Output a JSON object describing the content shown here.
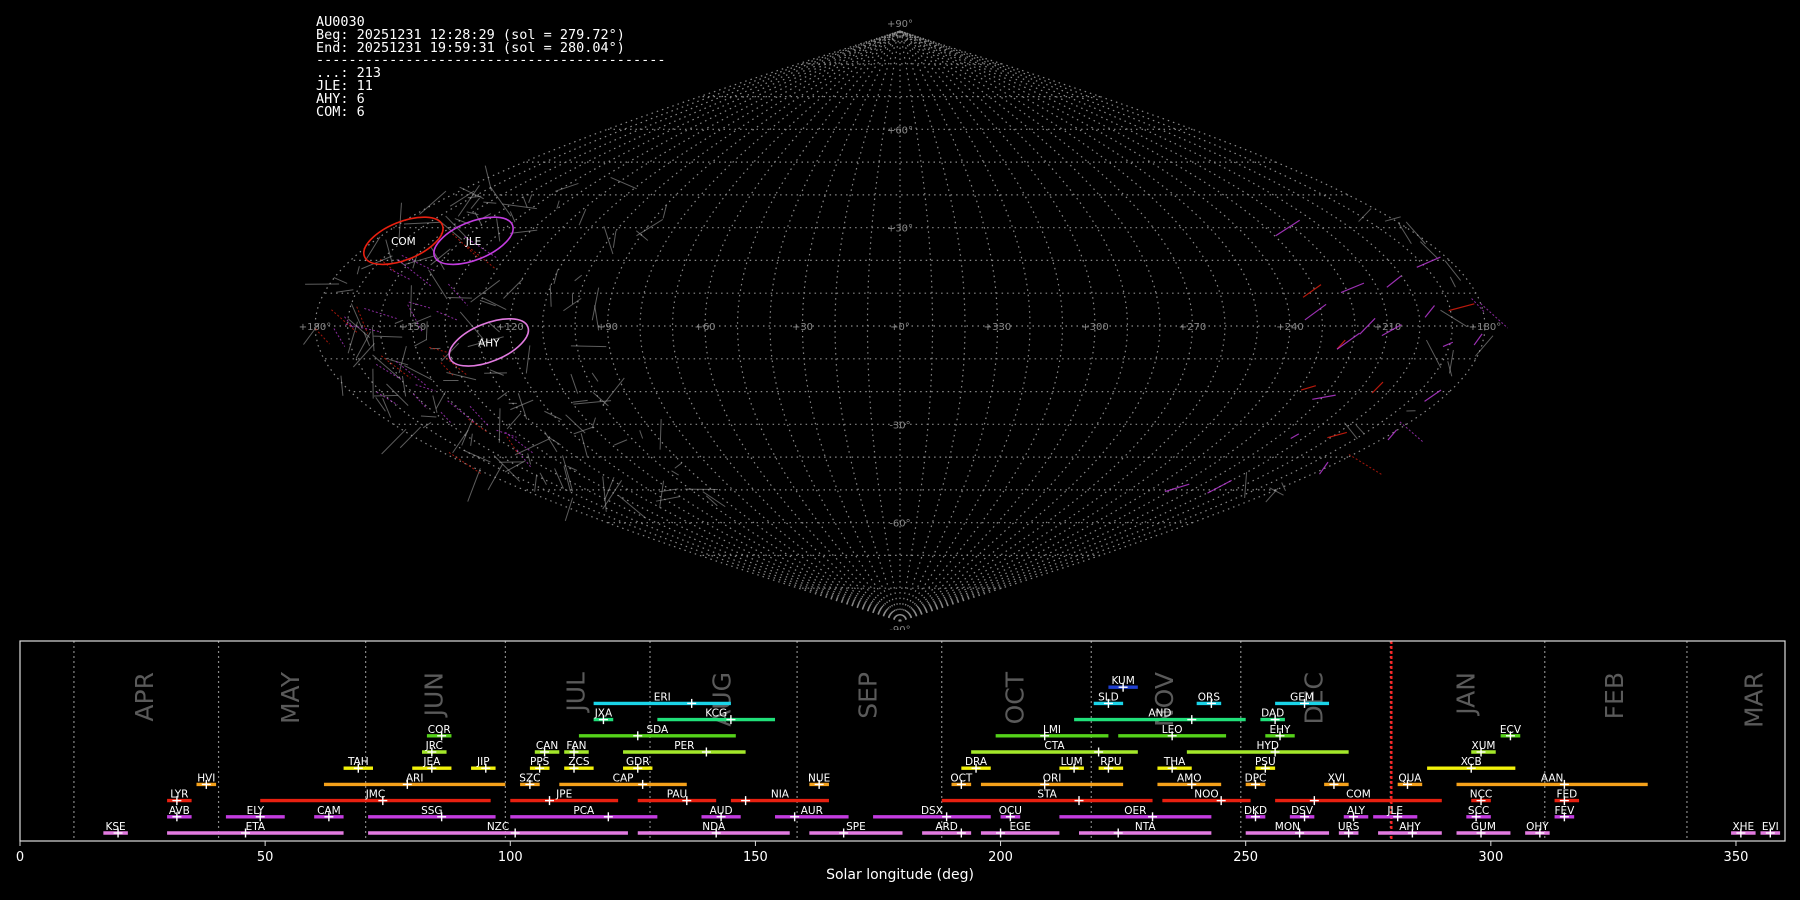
{
  "info": {
    "station": "AU0030",
    "begin": "Beg: 20251231 12:28:29 (sol = 279.72°)",
    "end": "End: 20251231 19:59:31 (sol = 280.04°)",
    "separator": "-------------------------------------------",
    "counts": [
      {
        "code": "...",
        "count": 213
      },
      {
        "code": "JLE",
        "count": 11
      },
      {
        "code": "AHY",
        "count": 6
      },
      {
        "code": "COM",
        "count": 6
      }
    ]
  },
  "colors": {
    "background": "#000000",
    "grid": "#8a8a8a",
    "sporadic": "#aaaaaa",
    "current_sol_marker": "#ff2020",
    "shower_palette": {
      "blue": "#1f3fd0",
      "cyan": "#1ad4e8",
      "spring": "#20e07a",
      "green": "#55d21a",
      "lime": "#a4e82a",
      "yellow": "#f2f20a",
      "orange": "#f5a11a",
      "red": "#e82010",
      "magenta": "#c33ce0",
      "pink": "#e27ae0"
    }
  },
  "chart_data": [
    {
      "type": "scatter",
      "projection": "sinusoidal",
      "grid": true,
      "lon_tick_labels": [
        "+180°",
        "+150",
        "+120",
        "+90",
        "+60",
        "+30",
        "+0°",
        "+330",
        "+300",
        "+270",
        "+240",
        "+210",
        "+180°"
      ],
      "lat_tick_labels": [
        "+90°",
        "+60°",
        "+30°",
        "+0°",
        "-30°",
        "-60°",
        "-90°"
      ],
      "radiants": [
        {
          "code": "COM",
          "lon": 170,
          "lat": 26,
          "color": "#e82010"
        },
        {
          "code": "JLE",
          "lon": 146,
          "lat": 26,
          "color": "#c33ce0"
        },
        {
          "code": "AHY",
          "lon": 127,
          "lat": -5,
          "color": "#e27ae0"
        }
      ]
    },
    {
      "type": "timeline",
      "xlabel": "Solar longitude (deg)",
      "xlim": [
        0,
        360
      ],
      "grid": true,
      "x_ticks": [
        0,
        50,
        100,
        150,
        200,
        250,
        300,
        350
      ],
      "current_sol": 279.72,
      "months": [
        {
          "label": "APR",
          "start": 11,
          "end": 40.5
        },
        {
          "label": "MAY",
          "start": 40.5,
          "end": 70.5
        },
        {
          "label": "JUN",
          "start": 70.5,
          "end": 99
        },
        {
          "label": "JUL",
          "start": 99,
          "end": 128.5
        },
        {
          "label": "AUG",
          "start": 128.5,
          "end": 158.5
        },
        {
          "label": "SEP",
          "start": 158.5,
          "end": 188
        },
        {
          "label": "OCT",
          "start": 188,
          "end": 218.5
        },
        {
          "label": "NOV",
          "start": 218.5,
          "end": 249
        },
        {
          "label": "DEC",
          "start": 249,
          "end": 279.5
        },
        {
          "label": "JAN",
          "start": 279.5,
          "end": 311
        },
        {
          "label": "FEB",
          "start": 311,
          "end": 340
        },
        {
          "label": "MAR",
          "start": 340,
          "end": 371
        }
      ],
      "showers": [
        {
          "code": "KUM",
          "start": 222,
          "end": 228,
          "peak": 225,
          "row": 9,
          "color": "#1f3fd0"
        },
        {
          "code": "ERI",
          "start": 117,
          "end": 145,
          "peak": 137,
          "row": 8,
          "color": "#1ad4e8"
        },
        {
          "code": "SLD",
          "start": 219,
          "end": 225,
          "peak": 222,
          "row": 8,
          "color": "#1ad4e8"
        },
        {
          "code": "ORS",
          "start": 240,
          "end": 245,
          "peak": 243,
          "row": 8,
          "color": "#1ad4e8"
        },
        {
          "code": "GEM",
          "start": 256,
          "end": 267,
          "peak": 262,
          "row": 8,
          "color": "#1ad4e8"
        },
        {
          "code": "JXA",
          "start": 117,
          "end": 121,
          "peak": 119,
          "row": 7,
          "color": "#20e07a"
        },
        {
          "code": "KCG",
          "start": 130,
          "end": 154,
          "peak": 145,
          "row": 7,
          "color": "#20e07a"
        },
        {
          "code": "AND",
          "start": 215,
          "end": 250,
          "peak": 239,
          "row": 7,
          "color": "#20e07a"
        },
        {
          "code": "DAD",
          "start": 253,
          "end": 258,
          "peak": 256,
          "row": 7,
          "color": "#20e07a"
        },
        {
          "code": "COR",
          "start": 83,
          "end": 88,
          "peak": 86,
          "row": 6,
          "color": "#55d21a"
        },
        {
          "code": "SDA",
          "start": 114,
          "end": 146,
          "peak": 126,
          "row": 6,
          "color": "#55d21a"
        },
        {
          "code": "LMI",
          "start": 199,
          "end": 222,
          "peak": 209,
          "row": 6,
          "color": "#55d21a"
        },
        {
          "code": "LEO",
          "start": 224,
          "end": 246,
          "peak": 235,
          "row": 6,
          "color": "#55d21a"
        },
        {
          "code": "EHY",
          "start": 254,
          "end": 260,
          "peak": 257,
          "row": 6,
          "color": "#55d21a"
        },
        {
          "code": "ECV",
          "start": 302,
          "end": 306,
          "peak": 304,
          "row": 6,
          "color": "#55d21a"
        },
        {
          "code": "JRC",
          "start": 82,
          "end": 87,
          "peak": 84,
          "row": 5,
          "color": "#a4e82a"
        },
        {
          "code": "CAN",
          "start": 105,
          "end": 110,
          "peak": 107,
          "row": 5,
          "color": "#a4e82a"
        },
        {
          "code": "FAN",
          "start": 111,
          "end": 116,
          "peak": 113,
          "row": 5,
          "color": "#a4e82a"
        },
        {
          "code": "PER",
          "start": 123,
          "end": 148,
          "peak": 140,
          "row": 5,
          "color": "#a4e82a"
        },
        {
          "code": "CTA",
          "start": 194,
          "end": 228,
          "peak": 220,
          "row": 5,
          "color": "#a4e82a"
        },
        {
          "code": "HYD",
          "start": 238,
          "end": 271,
          "peak": 256,
          "row": 5,
          "color": "#a4e82a"
        },
        {
          "code": "XUM",
          "start": 296,
          "end": 301,
          "peak": 298,
          "row": 5,
          "color": "#a4e82a"
        },
        {
          "code": "TAH",
          "start": 66,
          "end": 72,
          "peak": 69,
          "row": 4,
          "color": "#f2f20a"
        },
        {
          "code": "JEA",
          "start": 80,
          "end": 88,
          "peak": 84,
          "row": 4,
          "color": "#f2f20a"
        },
        {
          "code": "JIP",
          "start": 92,
          "end": 97,
          "peak": 95,
          "row": 4,
          "color": "#f2f20a"
        },
        {
          "code": "PPS",
          "start": 104,
          "end": 108,
          "peak": 106,
          "row": 4,
          "color": "#f2f20a"
        },
        {
          "code": "ZCS",
          "start": 111,
          "end": 117,
          "peak": 113,
          "row": 4,
          "color": "#f2f20a"
        },
        {
          "code": "GDR",
          "start": 123,
          "end": 129,
          "peak": 126,
          "row": 4,
          "color": "#f2f20a"
        },
        {
          "code": "DRA",
          "start": 192,
          "end": 198,
          "peak": 195,
          "row": 4,
          "color": "#f2f20a"
        },
        {
          "code": "LUM",
          "start": 212,
          "end": 217,
          "peak": 215,
          "row": 4,
          "color": "#f2f20a"
        },
        {
          "code": "RPU",
          "start": 220,
          "end": 225,
          "peak": 222,
          "row": 4,
          "color": "#f2f20a"
        },
        {
          "code": "THA",
          "start": 232,
          "end": 239,
          "peak": 235,
          "row": 4,
          "color": "#f2f20a"
        },
        {
          "code": "PSU",
          "start": 252,
          "end": 256,
          "peak": 254,
          "row": 4,
          "color": "#f2f20a"
        },
        {
          "code": "XCB",
          "start": 287,
          "end": 305,
          "peak": 296,
          "row": 4,
          "color": "#f2f20a"
        },
        {
          "code": "HVI",
          "start": 36,
          "end": 40,
          "peak": 38,
          "row": 3,
          "color": "#f5a11a"
        },
        {
          "code": "ARI",
          "start": 62,
          "end": 99,
          "peak": 79,
          "row": 3,
          "color": "#f5a11a"
        },
        {
          "code": "SZC",
          "start": 102,
          "end": 106,
          "peak": 104,
          "row": 3,
          "color": "#f5a11a"
        },
        {
          "code": "CAP",
          "start": 110,
          "end": 136,
          "peak": 127,
          "row": 3,
          "color": "#f5a11a"
        },
        {
          "code": "NUE",
          "start": 161,
          "end": 165,
          "peak": 163,
          "row": 3,
          "color": "#f5a11a"
        },
        {
          "code": "OCT",
          "start": 190,
          "end": 194,
          "peak": 192,
          "row": 3,
          "color": "#f5a11a"
        },
        {
          "code": "ORI",
          "start": 196,
          "end": 225,
          "peak": 209,
          "row": 3,
          "color": "#f5a11a"
        },
        {
          "code": "AMO",
          "start": 232,
          "end": 245,
          "peak": 239,
          "row": 3,
          "color": "#f5a11a"
        },
        {
          "code": "DPC",
          "start": 250,
          "end": 254,
          "peak": 252,
          "row": 3,
          "color": "#f5a11a"
        },
        {
          "code": "XVI",
          "start": 266,
          "end": 271,
          "peak": 268,
          "row": 3,
          "color": "#f5a11a"
        },
        {
          "code": "QUA",
          "start": 281,
          "end": 286,
          "peak": 283,
          "row": 3,
          "color": "#f5a11a"
        },
        {
          "code": "AAN",
          "start": 293,
          "end": 332,
          "peak": 315,
          "row": 3,
          "color": "#f5a11a"
        },
        {
          "code": "LYR",
          "start": 30,
          "end": 35,
          "peak": 32,
          "row": 2,
          "color": "#e82010"
        },
        {
          "code": "JMC",
          "start": 49,
          "end": 96,
          "peak": 74,
          "row": 2,
          "color": "#e82010"
        },
        {
          "code": "JPE",
          "start": 100,
          "end": 122,
          "peak": 108,
          "row": 2,
          "color": "#e82010"
        },
        {
          "code": "PAU",
          "start": 126,
          "end": 142,
          "peak": 136,
          "row": 2,
          "color": "#e82010"
        },
        {
          "code": "NIA",
          "start": 145,
          "end": 165,
          "peak": 148,
          "row": 2,
          "color": "#e82010"
        },
        {
          "code": "STA",
          "start": 188,
          "end": 231,
          "peak": 216,
          "row": 2,
          "color": "#e82010"
        },
        {
          "code": "NOO",
          "start": 233,
          "end": 251,
          "peak": 245,
          "row": 2,
          "color": "#e82010"
        },
        {
          "code": "COM",
          "start": 256,
          "end": 290,
          "peak": 264,
          "row": 2,
          "color": "#e82010"
        },
        {
          "code": "NCC",
          "start": 296,
          "end": 300,
          "peak": 298,
          "row": 2,
          "color": "#e82010"
        },
        {
          "code": "FED",
          "start": 313,
          "end": 318,
          "peak": 315,
          "row": 2,
          "color": "#e82010"
        },
        {
          "code": "AVB",
          "start": 30,
          "end": 35,
          "peak": 32,
          "row": 1,
          "color": "#c33ce0"
        },
        {
          "code": "ELY",
          "start": 42,
          "end": 54,
          "peak": 49,
          "row": 1,
          "color": "#c33ce0"
        },
        {
          "code": "CAM",
          "start": 60,
          "end": 66,
          "peak": 63,
          "row": 1,
          "color": "#c33ce0"
        },
        {
          "code": "SSG",
          "start": 71,
          "end": 97,
          "peak": 86,
          "row": 1,
          "color": "#c33ce0"
        },
        {
          "code": "PCA",
          "start": 100,
          "end": 130,
          "peak": 120,
          "row": 1,
          "color": "#c33ce0"
        },
        {
          "code": "AUD",
          "start": 139,
          "end": 147,
          "peak": 143,
          "row": 1,
          "color": "#c33ce0"
        },
        {
          "code": "AUR",
          "start": 154,
          "end": 169,
          "peak": 158,
          "row": 1,
          "color": "#c33ce0"
        },
        {
          "code": "DSX",
          "start": 174,
          "end": 198,
          "peak": 189,
          "row": 1,
          "color": "#c33ce0"
        },
        {
          "code": "OCU",
          "start": 200,
          "end": 204,
          "peak": 202,
          "row": 1,
          "color": "#c33ce0"
        },
        {
          "code": "OER",
          "start": 212,
          "end": 243,
          "peak": 231,
          "row": 1,
          "color": "#c33ce0"
        },
        {
          "code": "DKD",
          "start": 250,
          "end": 254,
          "peak": 252,
          "row": 1,
          "color": "#c33ce0"
        },
        {
          "code": "DSV",
          "start": 259,
          "end": 264,
          "peak": 262,
          "row": 1,
          "color": "#c33ce0"
        },
        {
          "code": "ALY",
          "start": 270,
          "end": 275,
          "peak": 272,
          "row": 1,
          "color": "#c33ce0"
        },
        {
          "code": "JLE",
          "start": 276,
          "end": 285,
          "peak": 281,
          "row": 1,
          "color": "#c33ce0"
        },
        {
          "code": "SCC",
          "start": 295,
          "end": 300,
          "peak": 297,
          "row": 1,
          "color": "#c33ce0"
        },
        {
          "code": "FEV",
          "start": 313,
          "end": 317,
          "peak": 315,
          "row": 1,
          "color": "#c33ce0"
        },
        {
          "code": "KSE",
          "start": 17,
          "end": 22,
          "peak": 20,
          "row": 0,
          "color": "#e27ae0"
        },
        {
          "code": "ETA",
          "start": 30,
          "end": 66,
          "peak": 46,
          "row": 0,
          "color": "#e27ae0"
        },
        {
          "code": "NZC",
          "start": 71,
          "end": 124,
          "peak": 101,
          "row": 0,
          "color": "#e27ae0"
        },
        {
          "code": "NDA",
          "start": 126,
          "end": 157,
          "peak": 142,
          "row": 0,
          "color": "#e27ae0"
        },
        {
          "code": "SPE",
          "start": 161,
          "end": 180,
          "peak": 168,
          "row": 0,
          "color": "#e27ae0"
        },
        {
          "code": "ARD",
          "start": 184,
          "end": 194,
          "peak": 192,
          "row": 0,
          "color": "#e27ae0"
        },
        {
          "code": "EGE",
          "start": 196,
          "end": 212,
          "peak": 200,
          "row": 0,
          "color": "#e27ae0"
        },
        {
          "code": "NTA",
          "start": 216,
          "end": 243,
          "peak": 224,
          "row": 0,
          "color": "#e27ae0"
        },
        {
          "code": "MON",
          "start": 250,
          "end": 267,
          "peak": 261,
          "row": 0,
          "color": "#e27ae0"
        },
        {
          "code": "URS",
          "start": 269,
          "end": 273,
          "peak": 271,
          "row": 0,
          "color": "#e27ae0"
        },
        {
          "code": "AHY",
          "start": 277,
          "end": 290,
          "peak": 284,
          "row": 0,
          "color": "#e27ae0"
        },
        {
          "code": "GUM",
          "start": 293,
          "end": 304,
          "peak": 298,
          "row": 0,
          "color": "#e27ae0"
        },
        {
          "code": "OHY",
          "start": 307,
          "end": 312,
          "peak": 310,
          "row": 0,
          "color": "#e27ae0"
        },
        {
          "code": "XHE",
          "start": 349,
          "end": 354,
          "peak": 351,
          "row": 0,
          "color": "#e27ae0"
        },
        {
          "code": "EVI",
          "start": 355,
          "end": 359,
          "peak": 357,
          "row": 0,
          "color": "#e27ae0"
        }
      ]
    }
  ]
}
